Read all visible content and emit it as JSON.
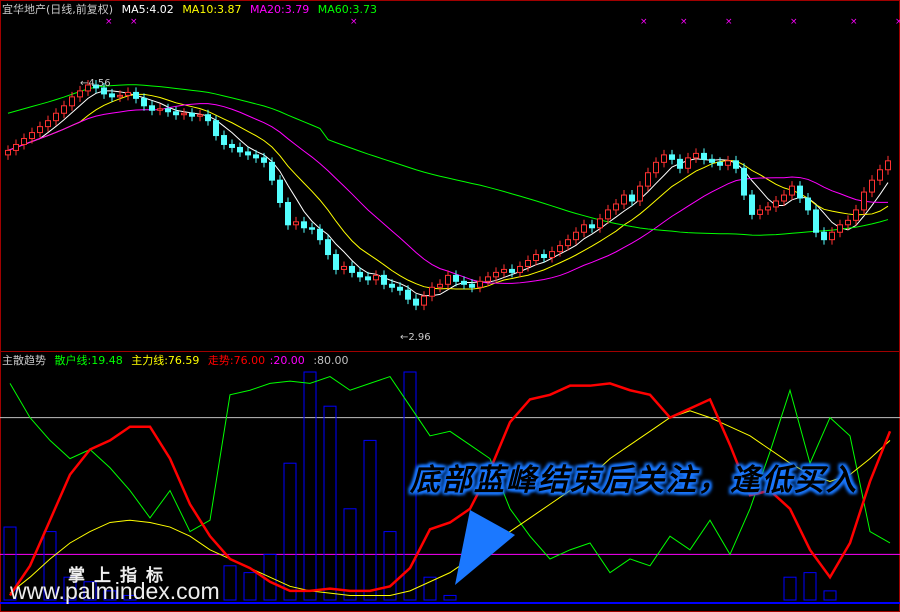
{
  "title": "宜华地产(日线,前复权)",
  "top_legend": [
    {
      "text": "MA5:4.02",
      "color": "#ffffff"
    },
    {
      "text": "MA10:3.87",
      "color": "#ffff00"
    },
    {
      "text": "MA20:3.79",
      "color": "#ff00ff"
    },
    {
      "text": "MA60:3.73",
      "color": "#00ff00"
    }
  ],
  "bottom_legend": {
    "name": "主散趋势",
    "items": [
      {
        "text": "散户线:19.48",
        "color": "#00ff00"
      },
      {
        "text": "主力线:76.59",
        "color": "#ffff00"
      },
      {
        "text": "走势:76.00",
        "color": "#ff0000"
      },
      {
        "text": ":20.00",
        "color": "#ff00ff"
      },
      {
        "text": ":80.00",
        "color": "#c0c0c0"
      }
    ]
  },
  "banner": "底部蓝峰结束后关注，逢低买入",
  "logo_cn": "掌上指标",
  "logo_url": "www.palmindex.com",
  "colors": {
    "up": "#ff3232",
    "down": "#54ffff",
    "border": "#a00000",
    "banner": "#1b78ff"
  },
  "chart_data": [
    {
      "type": "candlestick",
      "title": "宜华地产(日线,前复权)",
      "annotations": [
        {
          "text": "4.56",
          "kind": "high"
        },
        {
          "text": "2.96",
          "kind": "low"
        }
      ],
      "ylim": [
        2.8,
        4.75
      ],
      "close": [
        4.1,
        4.14,
        4.18,
        4.22,
        4.26,
        4.3,
        4.35,
        4.4,
        4.46,
        4.5,
        4.54,
        4.52,
        4.48,
        4.46,
        4.47,
        4.49,
        4.45,
        4.4,
        4.37,
        4.38,
        4.36,
        4.34,
        4.35,
        4.33,
        4.34,
        4.3,
        4.2,
        4.14,
        4.12,
        4.09,
        4.07,
        4.05,
        4.02,
        3.9,
        3.75,
        3.6,
        3.62,
        3.58,
        3.57,
        3.5,
        3.4,
        3.3,
        3.32,
        3.28,
        3.25,
        3.23,
        3.26,
        3.2,
        3.18,
        3.16,
        3.1,
        3.06,
        3.12,
        3.18,
        3.2,
        3.26,
        3.22,
        3.2,
        3.18,
        3.22,
        3.25,
        3.28,
        3.3,
        3.28,
        3.32,
        3.36,
        3.4,
        3.38,
        3.42,
        3.46,
        3.5,
        3.55,
        3.6,
        3.58,
        3.64,
        3.7,
        3.74,
        3.8,
        3.76,
        3.86,
        3.95,
        4.02,
        4.07,
        4.04,
        3.98,
        4.05,
        4.08,
        4.04,
        4.02,
        4.0,
        4.03,
        3.98,
        3.8,
        3.67,
        3.7,
        3.72,
        3.76,
        3.8,
        3.86,
        3.78,
        3.7,
        3.55,
        3.5,
        3.55,
        3.6,
        3.63,
        3.7,
        3.82,
        3.9,
        3.97,
        4.03
      ],
      "ma_labels": [
        "MA5",
        "MA10",
        "MA20",
        "MA60"
      ]
    },
    {
      "type": "line",
      "title": "主散趋势",
      "ylim": [
        0,
        100
      ],
      "reference_lines": [
        20,
        80
      ],
      "series": [
        {
          "name": "走势",
          "color": "#ff0000",
          "values": [
            2,
            15,
            35,
            55,
            66,
            70,
            76,
            76,
            62,
            42,
            28,
            18,
            14,
            8,
            4,
            4,
            5,
            4,
            4,
            6,
            14,
            31,
            34,
            40,
            57,
            78,
            88,
            90,
            94,
            94,
            95,
            92,
            90,
            80,
            84,
            88,
            68,
            46,
            48,
            40,
            22,
            10,
            25,
            52,
            74
          ]
        },
        {
          "name": "主力线",
          "color": "#ffff00",
          "values": [
            3,
            10,
            18,
            25,
            30,
            34,
            35,
            34,
            32,
            28,
            22,
            18,
            14,
            10,
            6,
            4,
            3,
            2,
            2,
            2,
            4,
            8,
            12,
            18,
            24,
            30,
            36,
            42,
            48,
            54,
            62,
            68,
            74,
            80,
            83,
            80,
            76,
            72,
            66,
            60,
            55,
            52,
            55,
            62,
            70
          ]
        },
        {
          "name": "散户线",
          "color": "#00ff00",
          "values": [
            95,
            80,
            70,
            62,
            66,
            58,
            48,
            36,
            48,
            30,
            35,
            90,
            92,
            95,
            96,
            95,
            98,
            92,
            95,
            98,
            85,
            72,
            74,
            68,
            62,
            40,
            28,
            18,
            22,
            25,
            12,
            18,
            15,
            28,
            22,
            35,
            20,
            40,
            65,
            92,
            60,
            80,
            72,
            30,
            25
          ]
        },
        {
          "type": "bar",
          "color": "#0000ff",
          "values": [
            32,
            0,
            30,
            10,
            8,
            4,
            2,
            0,
            0,
            0,
            0,
            15,
            12,
            20,
            60,
            100,
            85,
            40,
            70,
            30,
            100,
            10,
            2,
            0,
            0,
            0,
            0,
            0,
            0,
            0,
            0,
            0,
            0,
            0,
            0,
            0,
            0,
            0,
            0,
            10,
            12,
            4,
            0,
            0,
            0
          ]
        }
      ]
    }
  ]
}
